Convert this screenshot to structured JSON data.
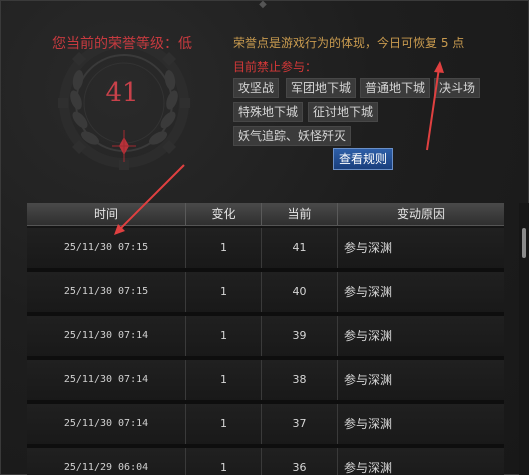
{
  "honor": {
    "level_text": "您当前的荣誉等级：低",
    "value": "41",
    "info_text": "荣誉点是游戏行为的体现，今日可恢复 5 点"
  },
  "ban": {
    "title": "目前禁止参与：",
    "tags": [
      "攻坚战",
      "军团地下城",
      "普通地下城",
      "决斗场",
      "特殊地下城",
      "征讨地下城",
      "妖气追踪、妖怪歼灭"
    ]
  },
  "rules_button": "查看规则",
  "table": {
    "headers": [
      "时间",
      "变化",
      "当前",
      "变动原因"
    ],
    "rows": [
      {
        "time": "25/11/30 07:15",
        "change": "1",
        "current": "41",
        "reason": "参与深渊"
      },
      {
        "time": "25/11/30 07:15",
        "change": "1",
        "current": "40",
        "reason": "参与深渊"
      },
      {
        "time": "25/11/30 07:14",
        "change": "1",
        "current": "39",
        "reason": "参与深渊"
      },
      {
        "time": "25/11/30 07:14",
        "change": "1",
        "current": "38",
        "reason": "参与深渊"
      },
      {
        "time": "25/11/30 07:14",
        "change": "1",
        "current": "37",
        "reason": "参与深渊"
      },
      {
        "time": "25/11/29 06:04",
        "change": "1",
        "current": "36",
        "reason": "参与深渊"
      }
    ]
  },
  "colors": {
    "accent_red": "#c63a3f",
    "info_gold": "#c99b4f",
    "annotation_arrow": "#e04040",
    "button_blue": "#1a3f7d"
  },
  "icons": [
    "gear-emblem-icon",
    "laurel-wreath-icon",
    "red-gem-icon",
    "annotation-arrow-icon"
  ]
}
